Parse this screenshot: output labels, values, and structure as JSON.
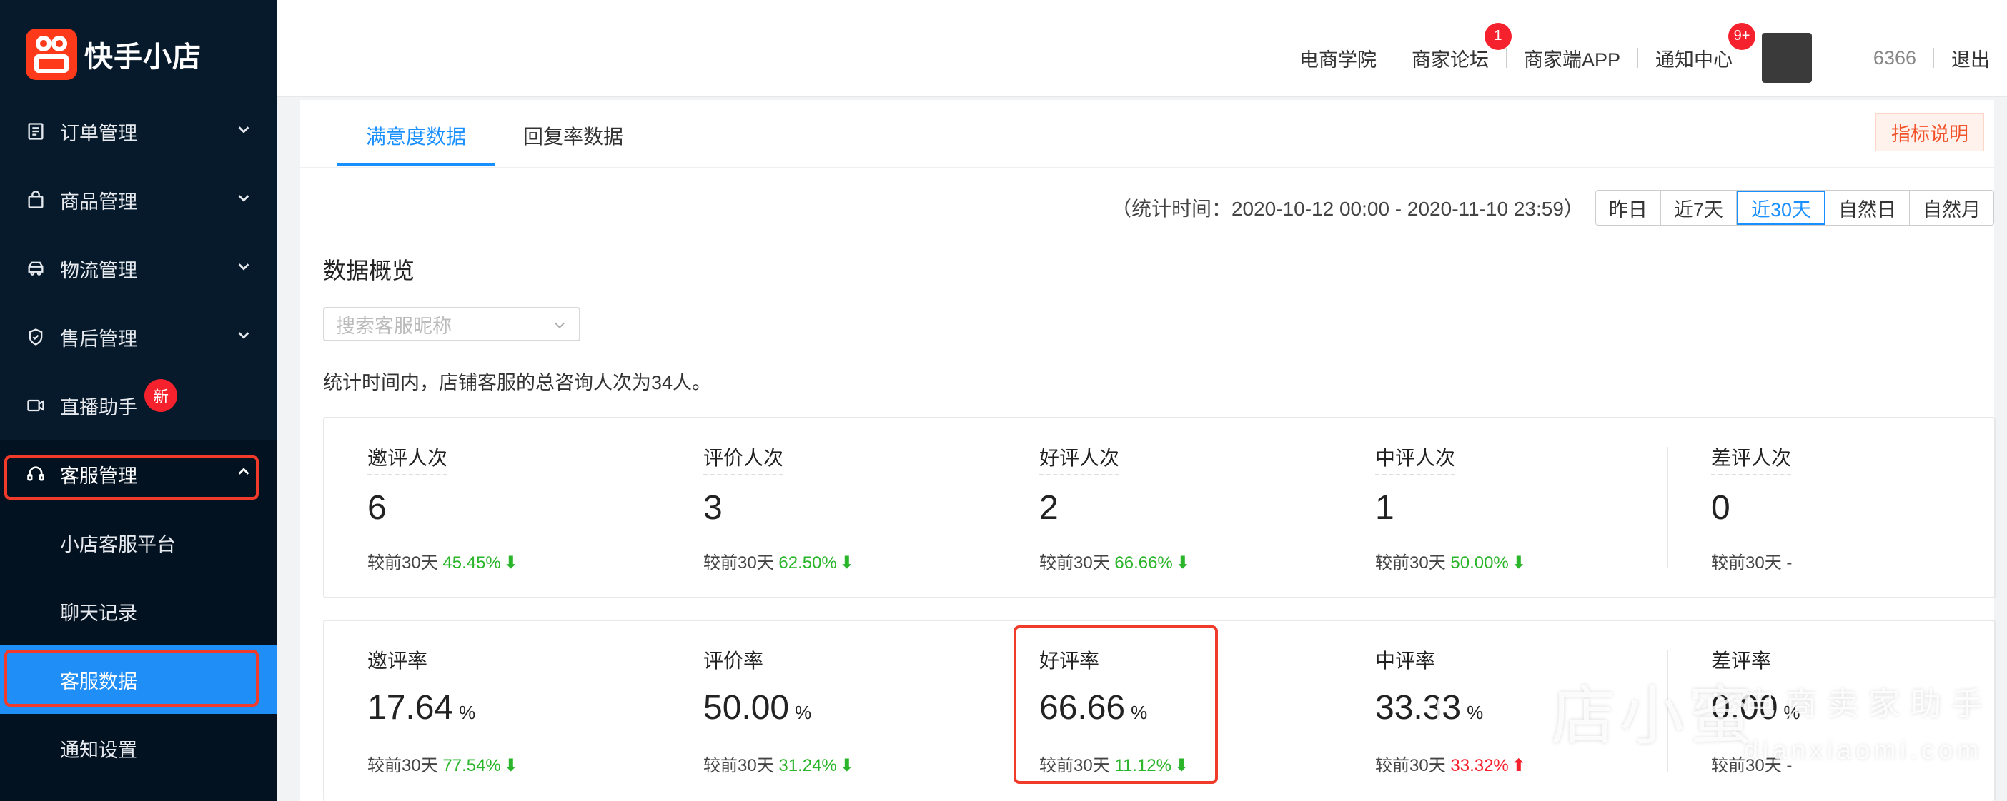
{
  "app": {
    "name": "快手小店"
  },
  "sidebar": {
    "items": [
      {
        "label": "订单管理",
        "icon": "order-list-icon"
      },
      {
        "label": "商品管理",
        "icon": "shopping-bag-icon"
      },
      {
        "label": "物流管理",
        "icon": "truck-icon"
      },
      {
        "label": "售后管理",
        "icon": "shield-check-icon"
      },
      {
        "label": "直播助手",
        "icon": "video-camera-icon",
        "badge": "新"
      },
      {
        "label": "客服管理",
        "icon": "headset-icon"
      }
    ],
    "sub_items": [
      {
        "label": "小店客服平台"
      },
      {
        "label": "聊天记录"
      },
      {
        "label": "客服数据"
      },
      {
        "label": "通知设置"
      }
    ]
  },
  "topbar": {
    "links": [
      {
        "label": "电商学院"
      },
      {
        "label": "商家论坛",
        "badge": "1"
      },
      {
        "label": "商家端APP"
      },
      {
        "label": "通知中心",
        "badge": "9+"
      }
    ],
    "account": "6366",
    "logout": "退出"
  },
  "tabs": [
    {
      "label": "满意度数据"
    },
    {
      "label": "回复率数据"
    }
  ],
  "hint_button": "指标说明",
  "time_range": {
    "text": "（统计时间：2020-10-12 00:00 - 2020-11-10 23:59）",
    "options": [
      "昨日",
      "近7天",
      "近30天",
      "自然日",
      "自然月"
    ]
  },
  "overview": {
    "title": "数据概览",
    "search_placeholder": "搜索客服昵称",
    "summary": "统计时间内，店铺客服的总咨询人次为34人。"
  },
  "counts": [
    {
      "label": "邀评人次",
      "value": "6",
      "cmp_prefix": "较前30天",
      "cmp": "45.45%",
      "arrow": "⬇"
    },
    {
      "label": "评价人次",
      "value": "3",
      "cmp_prefix": "较前30天",
      "cmp": "62.50%",
      "arrow": "⬇"
    },
    {
      "label": "好评人次",
      "value": "2",
      "cmp_prefix": "较前30天",
      "cmp": "66.66%",
      "arrow": "⬇"
    },
    {
      "label": "中评人次",
      "value": "1",
      "cmp_prefix": "较前30天",
      "cmp": "50.00%",
      "arrow": "⬇"
    },
    {
      "label": "差评人次",
      "value": "0",
      "cmp_prefix": "较前30天",
      "cmp": "-",
      "arrow": ""
    }
  ],
  "rates": [
    {
      "label": "邀评率",
      "value": "17.64",
      "unit": "%",
      "cmp_prefix": "较前30天",
      "cmp": "77.54%",
      "arrow": "⬇"
    },
    {
      "label": "评价率",
      "value": "50.00",
      "unit": "%",
      "cmp_prefix": "较前30天",
      "cmp": "31.24%",
      "arrow": "⬇"
    },
    {
      "label": "好评率",
      "value": "66.66",
      "unit": "%",
      "cmp_prefix": "较前30天",
      "cmp": "11.12%",
      "arrow": "⬇"
    },
    {
      "label": "中评率",
      "value": "33.33",
      "unit": "%",
      "cmp_prefix": "较前30天",
      "cmp": "33.32%",
      "arrow": "⬆"
    },
    {
      "label": "差评率",
      "value": "0.00",
      "unit": "%",
      "cmp_prefix": "较前30天",
      "cmp": "-",
      "arrow": ""
    }
  ],
  "watermark": {
    "main": "店小蜜",
    "sub": "电商卖家助手",
    "url": "dianxiaomi.com"
  },
  "colors": {
    "sidebar_bg": "#071a2b",
    "active": "#1f8ef7",
    "accent": "#1890ff",
    "highlight": "#f03a2a",
    "down": "#2ab52a",
    "up": "#f5222d"
  }
}
